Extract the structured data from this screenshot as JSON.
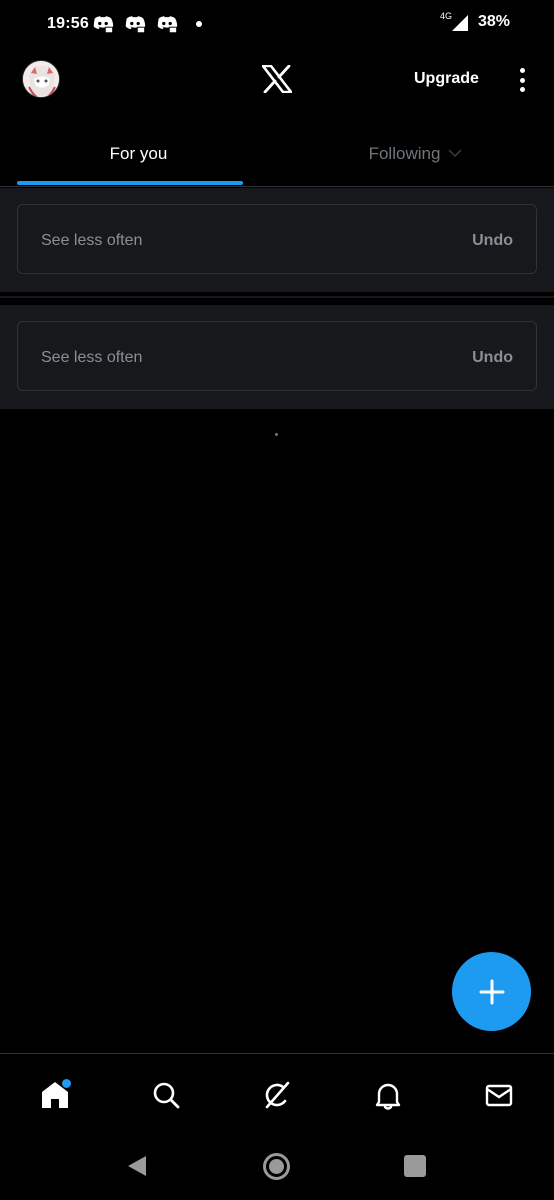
{
  "status_bar": {
    "time": "19:56",
    "notification_icons": [
      "discord-icon",
      "discord-icon",
      "discord-icon"
    ],
    "network": "4G",
    "battery": "38%"
  },
  "header": {
    "avatar_icon": "avatar",
    "logo_icon": "x-logo-icon",
    "upgrade_label": "Upgrade",
    "more_icon": "more-vertical-icon"
  },
  "tabs": [
    {
      "label": "For you",
      "selected": true
    },
    {
      "label": "Following",
      "selected": false
    }
  ],
  "feedback_cards": [
    {
      "text": "See less often",
      "action": "Undo"
    },
    {
      "text": "See less often",
      "action": "Undo"
    }
  ],
  "fab": {
    "icon": "plus-icon"
  },
  "bottom_nav": {
    "items": [
      {
        "icon": "home-icon",
        "active": true,
        "badge": true
      },
      {
        "icon": "search-icon",
        "active": false
      },
      {
        "icon": "grok-icon",
        "active": false
      },
      {
        "icon": "bell-icon",
        "active": false
      },
      {
        "icon": "mail-icon",
        "active": false
      }
    ]
  },
  "colors": {
    "background": "#000000",
    "accent": "#1d9bf0",
    "card_background": "#16181c",
    "border": "#2f3336",
    "muted_text": "#8b8f94"
  }
}
